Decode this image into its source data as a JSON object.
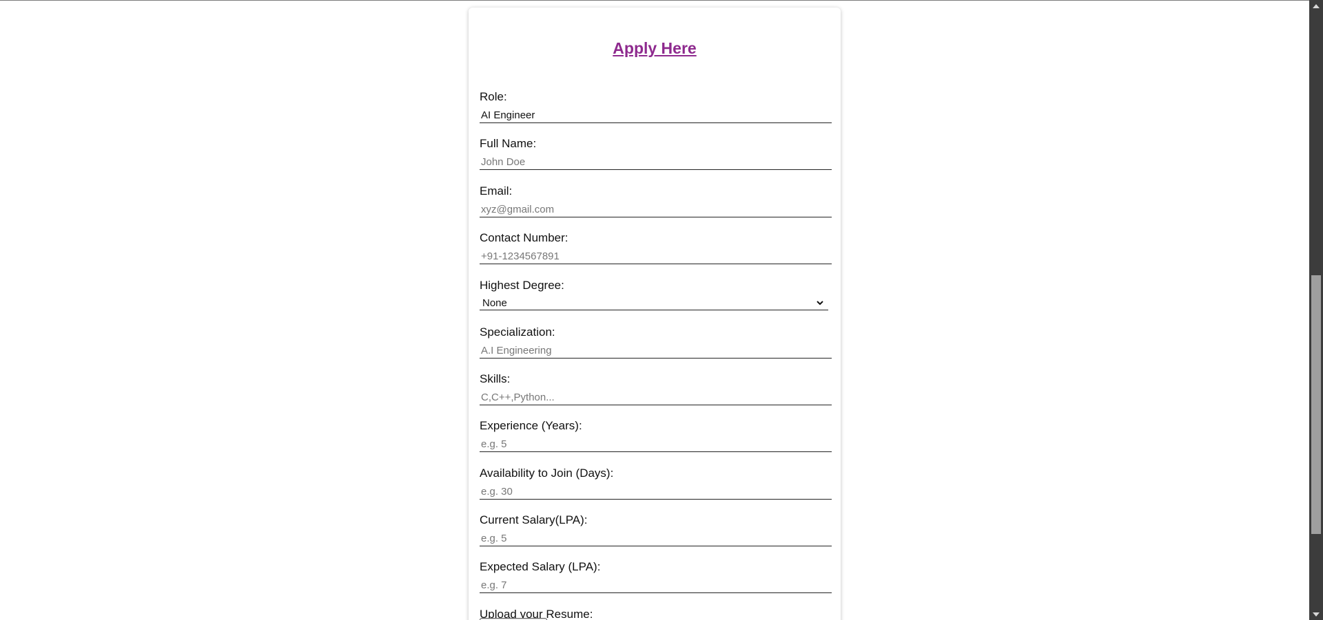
{
  "form": {
    "title": "Apply Here",
    "fields": [
      {
        "label": "Role:",
        "value": "AI Engineer",
        "placeholder": ""
      },
      {
        "label": "Full Name:",
        "value": "",
        "placeholder": "John Doe"
      },
      {
        "label": "Email:",
        "value": "",
        "placeholder": "xyz@gmail.com"
      },
      {
        "label": "Contact Number:",
        "value": "",
        "placeholder": "+91-1234567891"
      },
      {
        "label": "Highest Degree:",
        "value": "None",
        "placeholder": ""
      },
      {
        "label": "Specialization:",
        "value": "",
        "placeholder": "A.I Engineering"
      },
      {
        "label": "Skills:",
        "value": "",
        "placeholder": "C,C++,Python..."
      },
      {
        "label": "Experience (Years):",
        "value": "",
        "placeholder": "e.g. 5"
      },
      {
        "label": "Availability to Join (Days):",
        "value": "",
        "placeholder": "e.g. 30"
      },
      {
        "label": "Current Salary(LPA):",
        "value": "",
        "placeholder": "e.g. 5"
      },
      {
        "label": "Expected Salary (LPA):",
        "value": "",
        "placeholder": "e.g. 7"
      },
      {
        "label": "Upload your Resume:",
        "value": "",
        "placeholder": ""
      }
    ]
  },
  "colors": {
    "title": "#8e2a8e",
    "scrollbar_track": "#3c3c3c",
    "scrollbar_thumb": "#9f9f9f"
  },
  "icons": {
    "select": "chevron-down-icon",
    "scroll_up": "arrow-up-icon",
    "scroll_down": "arrow-down-icon"
  }
}
